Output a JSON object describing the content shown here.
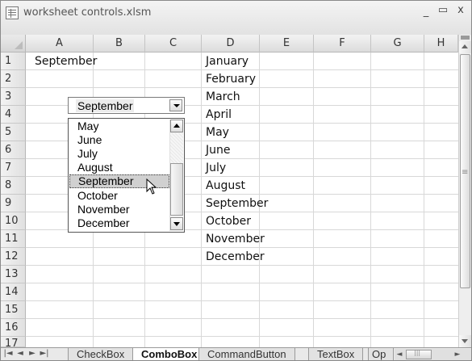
{
  "window": {
    "title": "worksheet controls.xlsm",
    "controls": {
      "minimize": "_",
      "maximize": "▭",
      "close": "x"
    }
  },
  "columns": [
    "A",
    "B",
    "C",
    "D",
    "E",
    "F",
    "G",
    "H"
  ],
  "rows": [
    "1",
    "2",
    "3",
    "4",
    "5",
    "6",
    "7",
    "8",
    "9",
    "10",
    "11",
    "12",
    "13",
    "14",
    "15",
    "16",
    "17"
  ],
  "cells": {
    "A1": "September",
    "D1": "January",
    "D2": "February",
    "D3": "March",
    "D4": "April",
    "D5": "May",
    "D6": "June",
    "D7": "July",
    "D8": "August",
    "D9": "September",
    "D10": "October",
    "D11": "November",
    "D12": "December"
  },
  "combobox": {
    "value": "September",
    "list_items": [
      "May",
      "June",
      "July",
      "August",
      "September",
      "October",
      "November",
      "December"
    ],
    "selected_index": 4
  },
  "sheet_tabs": [
    "CheckBox",
    "ComboBox",
    "CommandButton",
    "TextBox",
    "Op"
  ],
  "active_tab": "ComboBox",
  "tab_nav": [
    "|◄",
    "◄",
    "►",
    "►|"
  ],
  "icons": {
    "title": "spreadsheet-icon",
    "cursor": "arrow-cursor-icon"
  },
  "colors": {
    "header_bg": "#e0e0e0",
    "grid_line": "#d8d8d8",
    "selected_item_bg": "#d0d0d0"
  }
}
